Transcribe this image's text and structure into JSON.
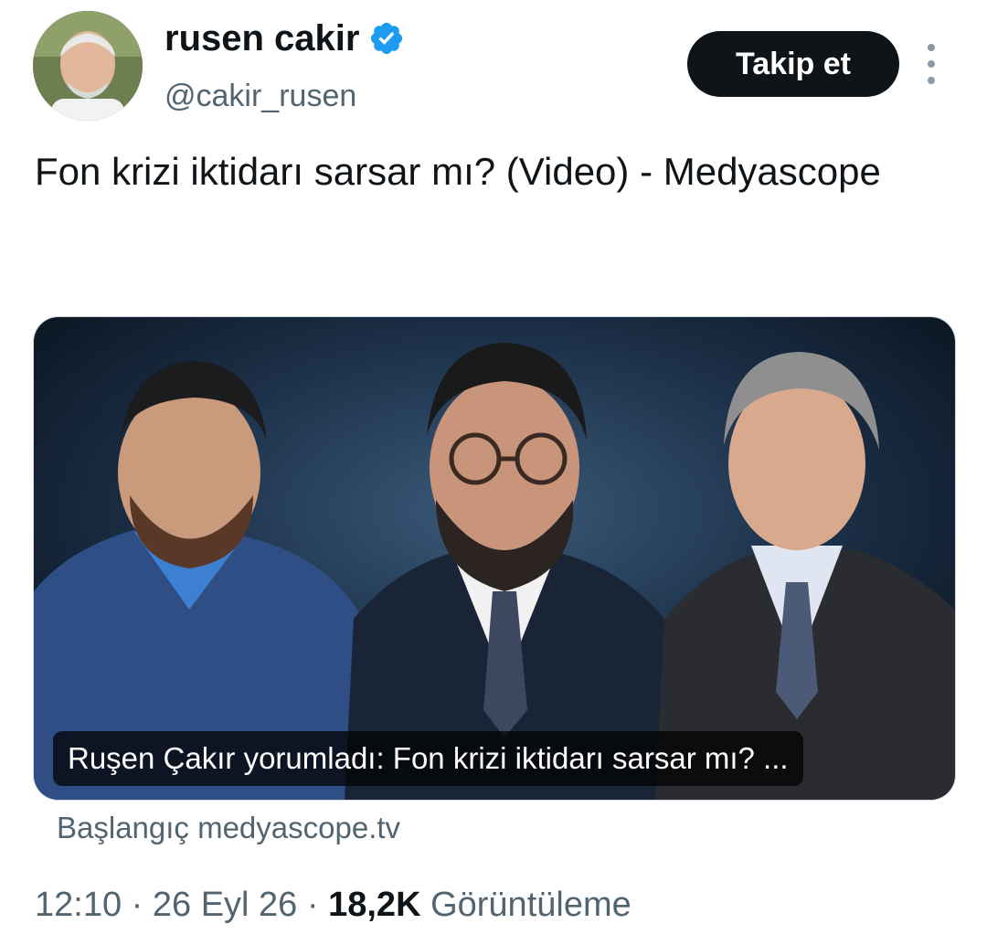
{
  "author": {
    "display_name": "rusen cakir",
    "handle": "@cakir_rusen",
    "verified_icon": "verified-badge-icon",
    "avatar": "avatar-photo"
  },
  "actions": {
    "follow_label": "Takip et",
    "more_icon": "more-vertical-icon"
  },
  "tweet": {
    "text": "Fon krizi iktidarı sarsar mı? (Video) - Medyascope"
  },
  "card": {
    "image": "three-men-portrait-thumbnail",
    "caption": "Ruşen Çakır yorumladı: Fon krizi iktidarı sarsar mı? ...",
    "source": "Başlangıç medyascope.tv"
  },
  "meta": {
    "time": "12:10",
    "sep1": "·",
    "date": "26 Eyl 26",
    "sep2": "·",
    "views_count": "18,2K",
    "views_label": "Görüntüleme"
  },
  "colors": {
    "text_primary": "#0f1419",
    "text_secondary": "#536471",
    "verified_blue": "#1d9bf0",
    "button_bg": "#0f1419"
  }
}
